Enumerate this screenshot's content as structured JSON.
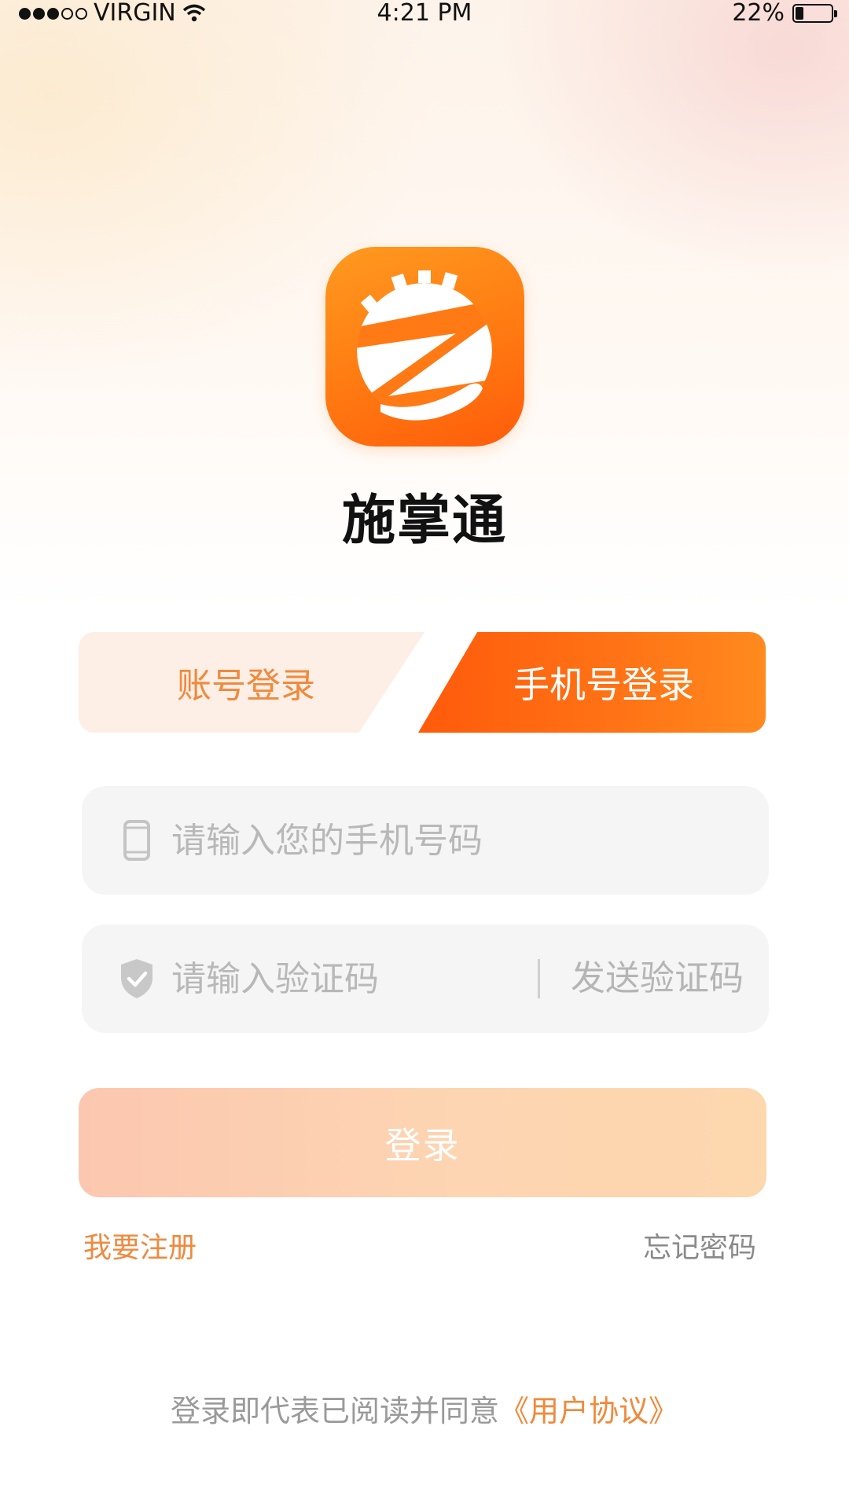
{
  "status_bar": {
    "carrier": "VIRGIN",
    "time": "4:21 PM",
    "battery": "22%",
    "battery_level": 0.22
  },
  "app": {
    "name": "施掌通"
  },
  "tabs": [
    {
      "label": "账号登录",
      "active": false
    },
    {
      "label": "手机号登录",
      "active": true
    }
  ],
  "form": {
    "phone_placeholder": "请输入您的手机号码",
    "code_placeholder": "请输入验证码",
    "send_code_label": "发送验证码",
    "login_label": "登录"
  },
  "links": {
    "register": "我要注册",
    "forgot_password": "忘记密码"
  },
  "agreement": {
    "text": "登录即代表已阅读并同意",
    "link": "《用户协议》"
  },
  "colors": {
    "accent": "#ff6a12",
    "accent_text": "#f08a3c",
    "input_bg": "#f5f5f5",
    "disabled_button": "#fdd0b2"
  }
}
